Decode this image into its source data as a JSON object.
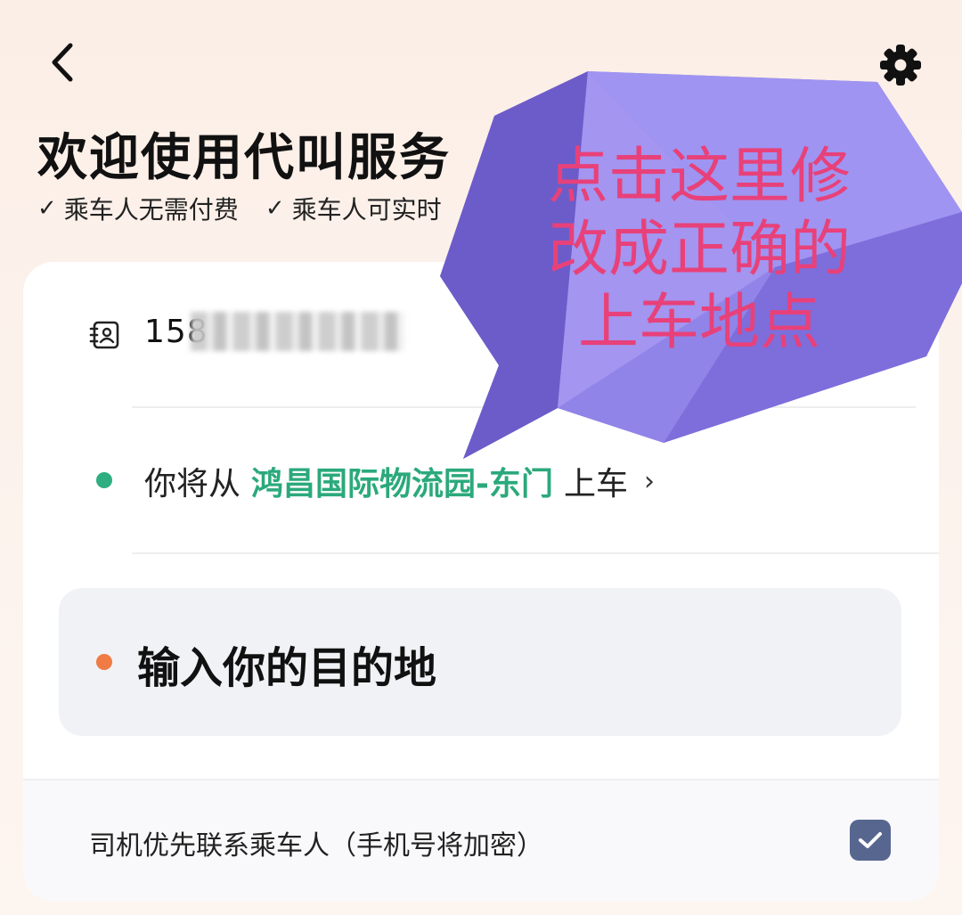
{
  "header": {
    "title": "欢迎使用代叫服务",
    "benefits": [
      {
        "check": "✓",
        "label": "乘车人无需付费"
      },
      {
        "check": "✓",
        "label": "乘车人可实时"
      }
    ]
  },
  "icons": {
    "back": "chevron-left-icon",
    "settings": "gear-icon",
    "contact": "contact-card-icon",
    "chevron": "›",
    "checkbox": "check-icon"
  },
  "form": {
    "phone_visible": "158",
    "pickup": {
      "prefix": "你将从",
      "location": "鸿昌国际物流园-东门",
      "suffix": "上车",
      "arrow": "›"
    },
    "destination_placeholder": "输入你的目的地",
    "driver_contact_option": "司机优先联系乘车人（手机号将加密）",
    "driver_contact_checked": true
  },
  "annotation": {
    "lines": [
      "点击这里修",
      "改成正确的",
      "上车地点"
    ]
  },
  "colors": {
    "pickup_dot": "#2fae7f",
    "pickup_location": "#2ba97c",
    "destination_dot": "#f07b45",
    "checkbox": "#56668f",
    "annotation_text": "#e8417a",
    "bubble": "#8b7be0"
  }
}
